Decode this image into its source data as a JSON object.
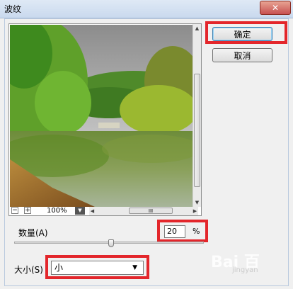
{
  "window": {
    "title": "波纹",
    "close_label": "✕"
  },
  "buttons": {
    "ok": "确定",
    "cancel": "取消"
  },
  "preview": {
    "zoom_out": "−",
    "zoom_in": "+",
    "zoom_level": "100%",
    "zoom_dropdown_icon": "triangle-down",
    "hscroll_grip": "III"
  },
  "amount": {
    "label": "数量(A)",
    "value": "20",
    "unit": "%",
    "slider_fraction": 0.51
  },
  "size": {
    "label": "大小(S)",
    "selected": "小"
  },
  "watermark": {
    "text": "Bai 百",
    "sub": "jingyan"
  },
  "colors": {
    "highlight": "#e3262b",
    "title_bar": "#c9d9ee"
  }
}
